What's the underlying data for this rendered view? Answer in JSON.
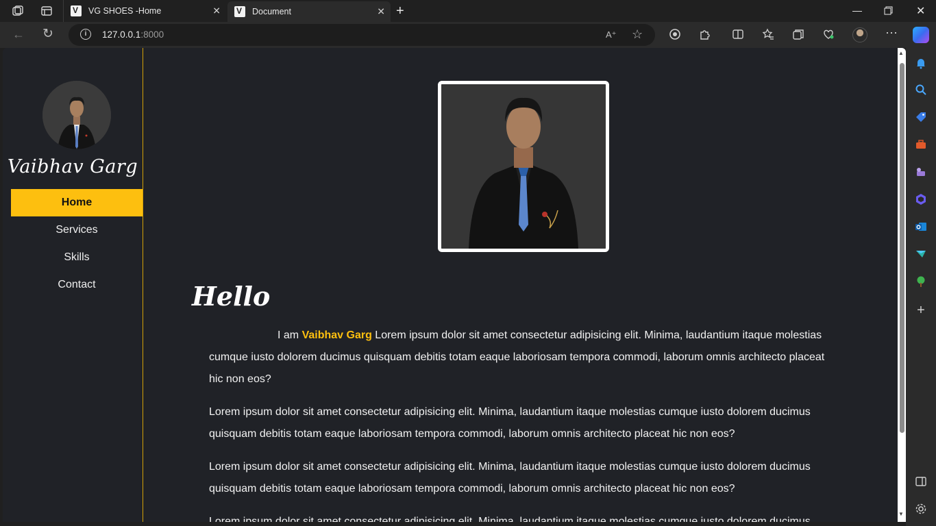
{
  "browser": {
    "tabs": [
      {
        "title": "VG SHOES -Home",
        "active": false
      },
      {
        "title": "Document",
        "active": true
      }
    ],
    "url_host": "127.0.0.1",
    "url_port": ":8000"
  },
  "site": {
    "name": "Vaibhav Garg",
    "menu": [
      "Home",
      "Services",
      "Skills",
      "Contact"
    ],
    "active_menu": "Home",
    "heading": "Hello",
    "intro_prefix": "I am",
    "intro_name": "Vaibhav Garg",
    "intro_rest": "Lorem ipsum dolor sit amet consectetur adipisicing elit. Minima, laudantium itaque molestias cumque iusto dolorem ducimus quisquam debitis totam eaque laboriosam tempora commodi, laborum omnis architecto placeat hic non eos?",
    "paragraphs": [
      "Lorem ipsum dolor sit amet consectetur adipisicing elit. Minima, laudantium itaque molestias cumque iusto dolorem ducimus quisquam debitis totam eaque laboriosam tempora commodi, laborum omnis architecto placeat hic non eos?",
      "Lorem ipsum dolor sit amet consectetur adipisicing elit. Minima, laudantium itaque molestias cumque iusto dolorem ducimus quisquam debitis totam eaque laboriosam tempora commodi, laborum omnis architecto placeat hic non eos?",
      "Lorem ipsum dolor sit amet consectetur adipisicing elit. Minima, laudantium itaque molestias cumque iusto dolorem ducimus"
    ]
  },
  "colors": {
    "accent": "#fdbf0f",
    "page_bg": "#202227",
    "text": "#f2f2f2"
  },
  "icons": {
    "tab_close": "✕",
    "new_tab": "+",
    "back": "←",
    "refresh": "↻"
  }
}
